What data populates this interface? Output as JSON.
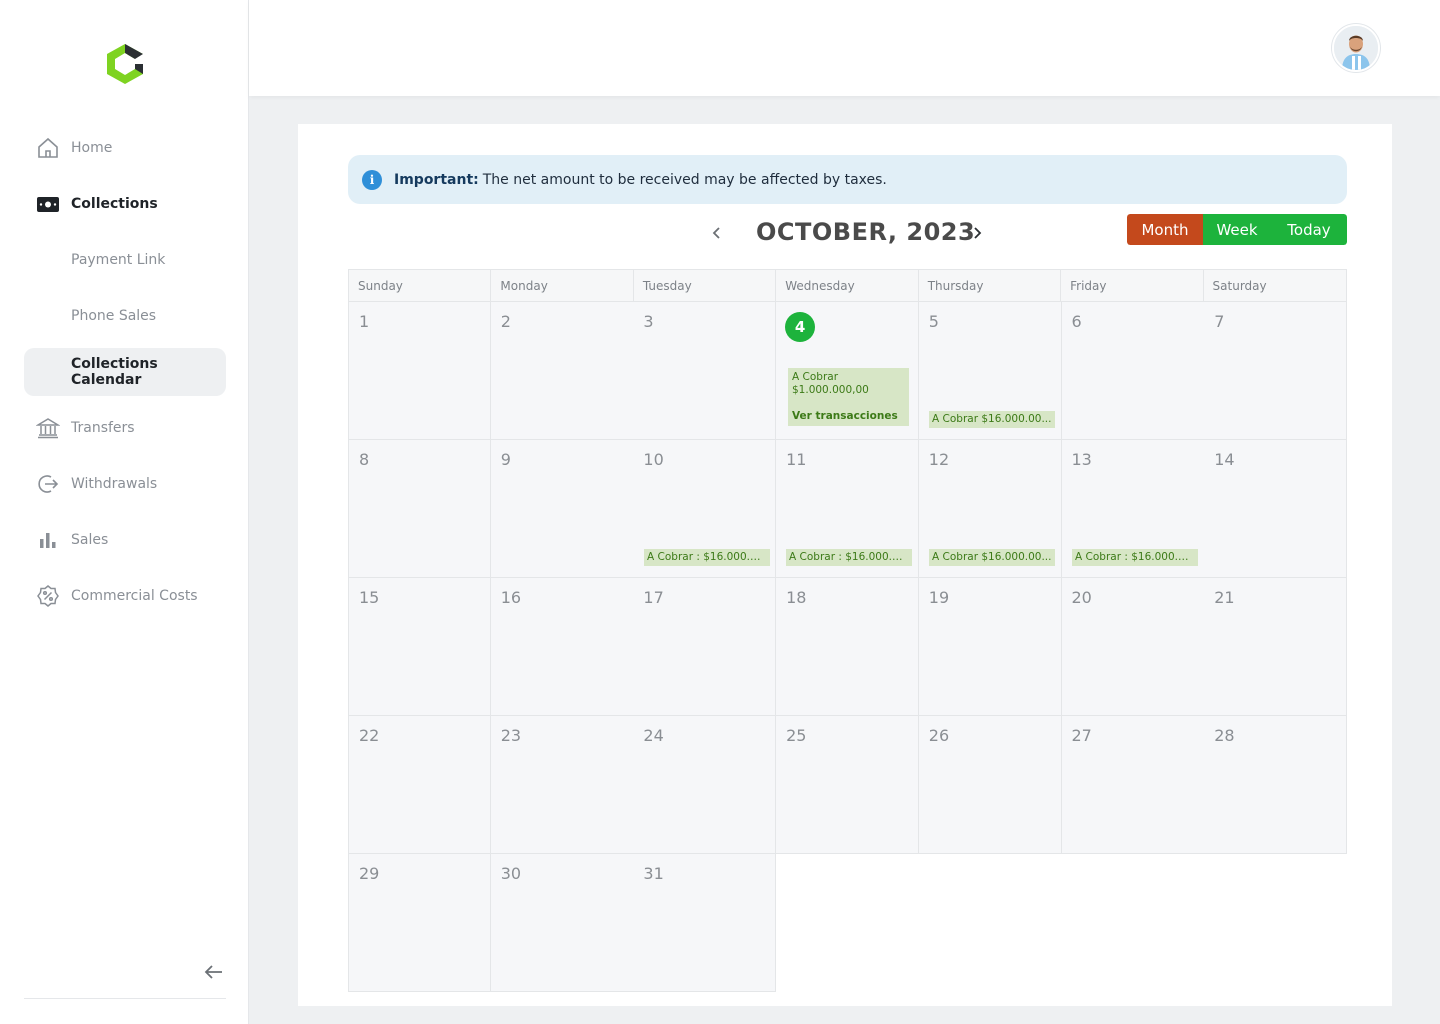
{
  "sidebar": {
    "logo": "brand-logo",
    "items": [
      {
        "label": "Home",
        "icon": "home-icon"
      },
      {
        "label": "Collections",
        "icon": "wallet-icon"
      },
      {
        "label": "Payment Link"
      },
      {
        "label": "Phone Sales"
      },
      {
        "label": "Collections Calendar"
      },
      {
        "label": "Transfers",
        "icon": "bank-icon"
      },
      {
        "label": "Withdrawals",
        "icon": "logout-icon"
      },
      {
        "label": "Sales",
        "icon": "bar-chart-icon"
      },
      {
        "label": "Commercial Costs",
        "icon": "percent-badge-icon"
      }
    ],
    "collapse_icon": "arrow-left-icon"
  },
  "header": {
    "avatar": "user-avatar"
  },
  "notice": {
    "strong": "Important:",
    "text": "The net amount to be received may be affected by taxes."
  },
  "calendar": {
    "title": "OCTOBER, 2023",
    "views": {
      "month": "Month",
      "week": "Week",
      "today": "Today"
    },
    "day_names": [
      "Sunday",
      "Monday",
      "Tuesday",
      "Wednesday",
      "Thursday",
      "Friday",
      "Saturday"
    ],
    "today": 4,
    "days": [
      "1",
      "2",
      "3",
      "4",
      "5",
      "6",
      "7",
      "8",
      "9",
      "10",
      "11",
      "12",
      "13",
      "14",
      "15",
      "16",
      "17",
      "18",
      "19",
      "20",
      "21",
      "22",
      "23",
      "24",
      "25",
      "26",
      "27",
      "28",
      "29",
      "30",
      "31"
    ],
    "events": {
      "d4_title": "A Cobrar",
      "d4_amount": "$1.000.000,00",
      "d4_link": "Ver transacciones",
      "d5": "A Cobrar $16.000.00...",
      "d10": "A Cobrar : $16.000.00...",
      "d11": "A Cobrar : $16.000.00...",
      "d12": "A Cobrar $16.000.00...",
      "d13": "A Cobrar : $16.000.00..."
    }
  },
  "colors": {
    "accent_green": "#1db33c",
    "month_orange": "#c4491c",
    "event_bg": "#d7e6c6"
  }
}
